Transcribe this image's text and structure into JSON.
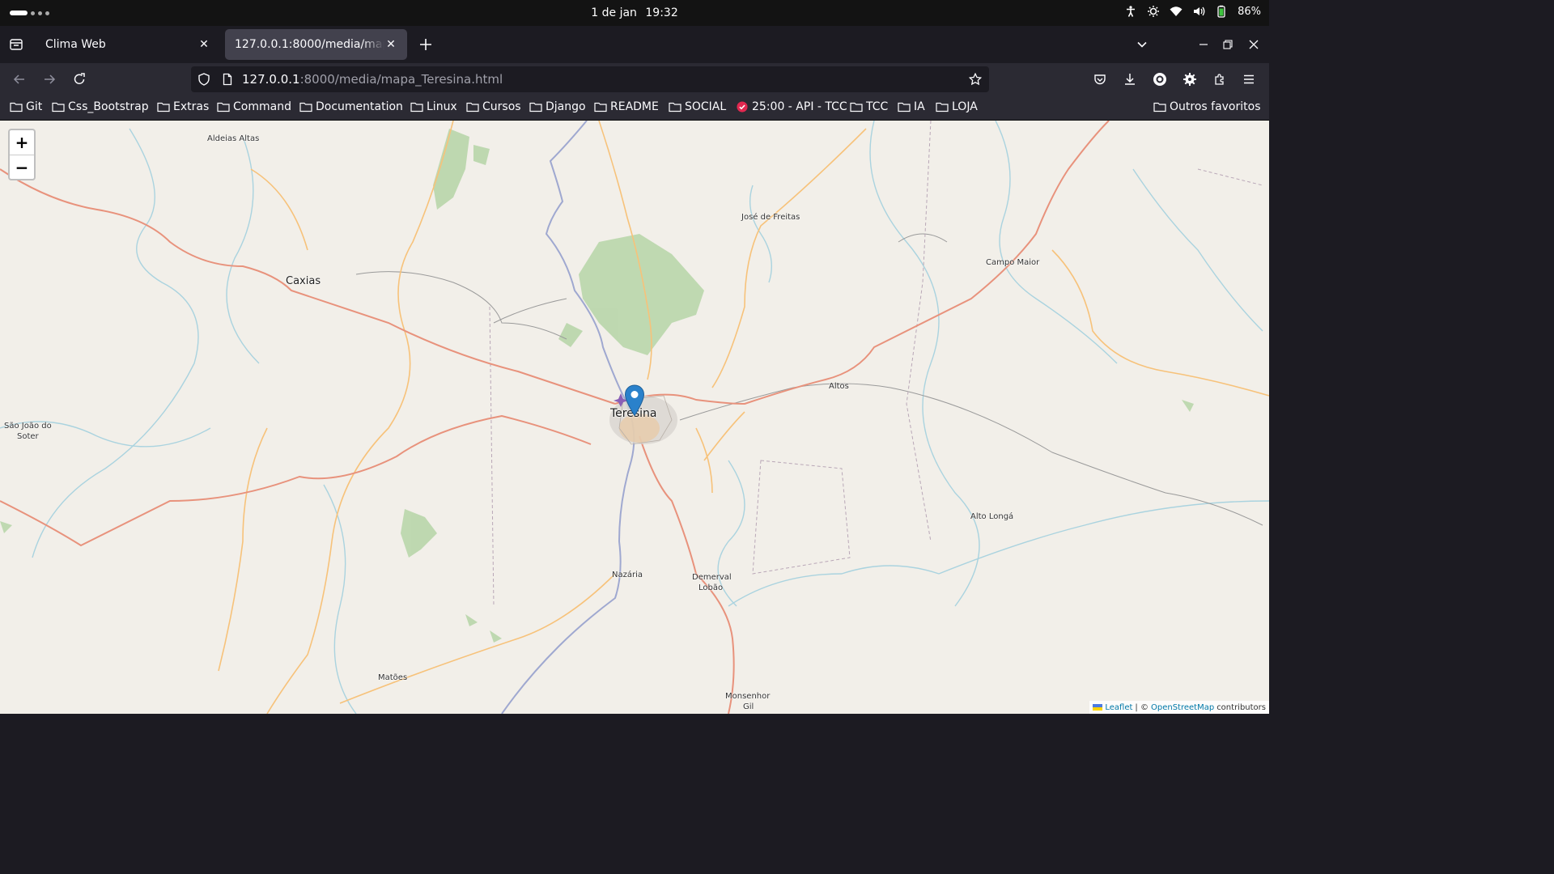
{
  "system_bar": {
    "date": "1 de jan",
    "time": "19:32",
    "battery": "86%",
    "icons": [
      "accessibility-icon",
      "brightness-icon",
      "wifi-icon",
      "volume-icon",
      "battery-icon"
    ]
  },
  "tabs": [
    {
      "title": "Clima Web",
      "active": false
    },
    {
      "title": "127.0.0.1:8000/media/mapa_Teresina.html",
      "active": true
    }
  ],
  "url": {
    "host": "127.0.0.1",
    "rest": ":8000/media/mapa_Teresina.html"
  },
  "bookmarks": [
    {
      "label": "Git",
      "icon": "folder-icon"
    },
    {
      "label": "Css_Bootstrap",
      "icon": "folder-icon"
    },
    {
      "label": "Extras",
      "icon": "folder-icon"
    },
    {
      "label": "Command",
      "icon": "folder-icon"
    },
    {
      "label": "Documentation",
      "icon": "folder-icon"
    },
    {
      "label": "Linux",
      "icon": "folder-icon"
    },
    {
      "label": "Cursos",
      "icon": "folder-icon"
    },
    {
      "label": "Django",
      "icon": "folder-icon"
    },
    {
      "label": "README",
      "icon": "folder-icon"
    },
    {
      "label": "SOCIAL",
      "icon": "folder-icon"
    },
    {
      "label": "25:00 - API - TCC",
      "icon": "check-circle-icon"
    },
    {
      "label": "TCC",
      "icon": "folder-icon"
    },
    {
      "label": "IA",
      "icon": "folder-icon"
    },
    {
      "label": "LOJA",
      "icon": "folder-icon"
    }
  ],
  "other_bookmarks": "Outros favoritos",
  "map": {
    "zoom_in": "+",
    "zoom_out": "−",
    "places": {
      "aldeias_altas": "Aldeias Altas",
      "jose_de_freitas": "José de Freitas",
      "campo_maior": "Campo Maior",
      "caxias": "Caxias",
      "altos": "Altos",
      "teresina": "Teresina",
      "sao_joao_line1": "São João do",
      "sao_joao_line2": "Soter",
      "alto_longa": "Alto Longá",
      "nazaria": "Nazária",
      "demerval_line1": "Demerval",
      "demerval_line2": "Lobão",
      "matoes": "Matões",
      "monsenhor_line1": "Monsenhor",
      "monsenhor_line2": "Gil"
    },
    "attribution": {
      "leaflet": "Leaflet",
      "separator": "| ©",
      "osm": "OpenStreetMap",
      "contributors": "contributors"
    },
    "colors": {
      "background": "#f2efe9",
      "primary_road": "#e8927c",
      "secondary_road": "#f7c27a",
      "river": "#aad3df",
      "vegetation": "#add19e",
      "marker": "#2a81cb"
    }
  }
}
